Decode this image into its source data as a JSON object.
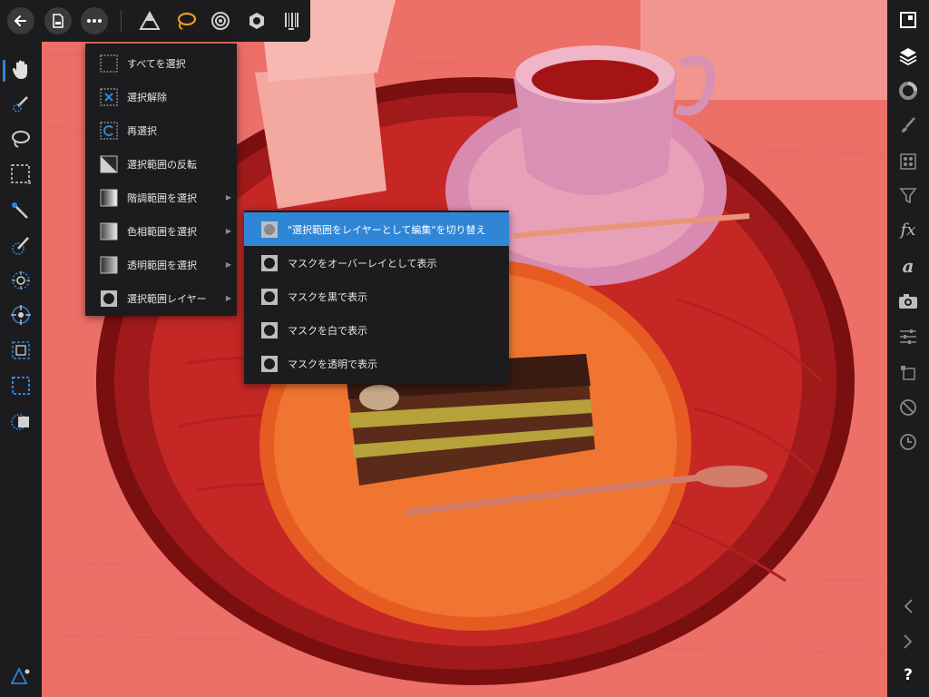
{
  "accent_color": "#2f86d6",
  "toolbar": {
    "back_icon": "back-arrow-icon",
    "document_icon": "document-icon",
    "more_icon": "more-ellipsis-icon",
    "personas": [
      "photo-persona-icon",
      "selection-persona-icon",
      "liquify-persona-icon",
      "develop-persona-icon",
      "export-persona-icon"
    ]
  },
  "left_tools": [
    "hand-tool-icon",
    "selection-brush-icon",
    "freehand-selection-icon",
    "marquee-icon",
    "wand-icon",
    "refine-icon",
    "radial-icon",
    "node-icon",
    "rect-select-icon",
    "rect-select-dashed-icon",
    "invert-icon"
  ],
  "main_menu": {
    "items": [
      {
        "label": "すべてを選択",
        "icon": "select-all-icon",
        "submenu": false
      },
      {
        "label": "選択解除",
        "icon": "deselect-icon",
        "submenu": false
      },
      {
        "label": "再選択",
        "icon": "reselect-icon",
        "submenu": false
      },
      {
        "label": "選択範囲の反転",
        "icon": "invert-selection-icon",
        "submenu": false
      },
      {
        "label": "階調範囲を選択",
        "icon": "tonal-range-icon",
        "submenu": true
      },
      {
        "label": "色相範囲を選択",
        "icon": "color-range-icon",
        "submenu": true
      },
      {
        "label": "透明範囲を選択",
        "icon": "transparency-range-icon",
        "submenu": true
      },
      {
        "label": "選択範囲レイヤー",
        "icon": "selection-layer-icon",
        "submenu": true
      }
    ]
  },
  "submenu": {
    "items": [
      {
        "label": "\"選択範囲をレイヤーとして編集\"を切り替え",
        "selected": true
      },
      {
        "label": "マスクをオーバーレイとして表示",
        "selected": false
      },
      {
        "label": "マスクを黒で表示",
        "selected": false
      },
      {
        "label": "マスクを白で表示",
        "selected": false
      },
      {
        "label": "マスクを透明で表示",
        "selected": false
      }
    ]
  },
  "right_studio": {
    "fx_label": "fx",
    "text_label": "a",
    "help_label": "?"
  }
}
